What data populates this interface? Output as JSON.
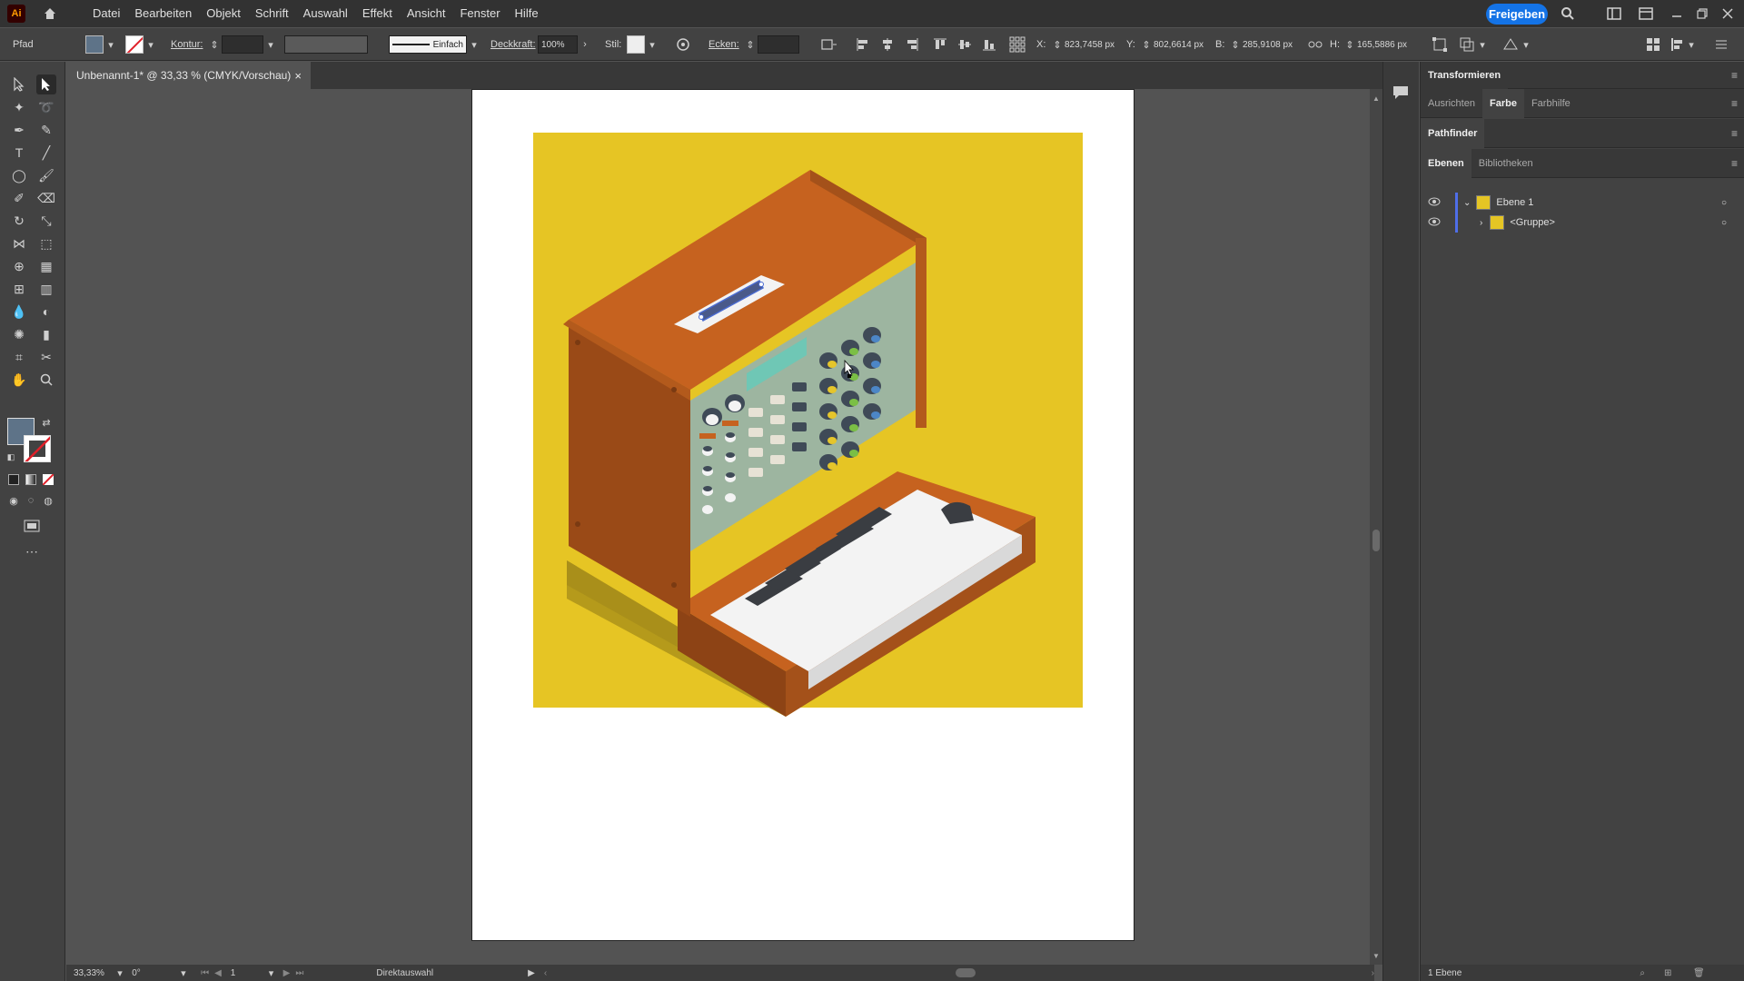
{
  "app": {
    "logo": "Ai",
    "share_label": "Freigeben"
  },
  "menu": [
    "Datei",
    "Bearbeiten",
    "Objekt",
    "Schrift",
    "Auswahl",
    "Effekt",
    "Ansicht",
    "Fenster",
    "Hilfe"
  ],
  "control": {
    "mode_label": "Pfad",
    "stroke_label": "Kontur:",
    "stroke_style": "Einfach",
    "opacity_label": "Deckkraft:",
    "opacity_value": "100%",
    "style_label": "Stil:",
    "corners_label": "Ecken:",
    "x_label": "X:",
    "x_value": "823,7458 px",
    "y_label": "Y:",
    "y_value": "802,6614 px",
    "w_label": "B:",
    "w_value": "285,9108 px",
    "h_label": "H:",
    "h_value": "165,5886 px",
    "fill_color": "#5e7388"
  },
  "document": {
    "tab_title": "Unbenannt-1* @ 33,33 % (CMYK/Vorschau)",
    "close_glyph": "×"
  },
  "status": {
    "zoom": "33,33%",
    "rotation": "0°",
    "artboard": "1",
    "tool": "Direktauswahl"
  },
  "panel": {
    "transform_title": "Transformieren",
    "tabs_row2": [
      "Ausrichten",
      "Farbe",
      "Farbhilfe"
    ],
    "pathfinder_title": "Pathfinder",
    "tabs_row4": [
      "Ebenen",
      "Bibliotheken"
    ],
    "layers": [
      {
        "name": "Ebene 1"
      },
      {
        "name": "<Gruppe>"
      }
    ],
    "footer_count": "1 Ebene"
  },
  "colors": {
    "background_yellow": "#e6c524",
    "case_orange": "#c6621f",
    "case_dark": "#9a4a17",
    "panel_sage": "#9db5a0",
    "knob_dark": "#3f4a57",
    "knob_blue": "#4c86c6",
    "knob_yellow": "#e5c52b",
    "knob_green": "#7bbf45",
    "screen_teal": "#6fc7b5",
    "keys_white": "#f3f3f3",
    "selection_blue": "#4a6bd0"
  }
}
